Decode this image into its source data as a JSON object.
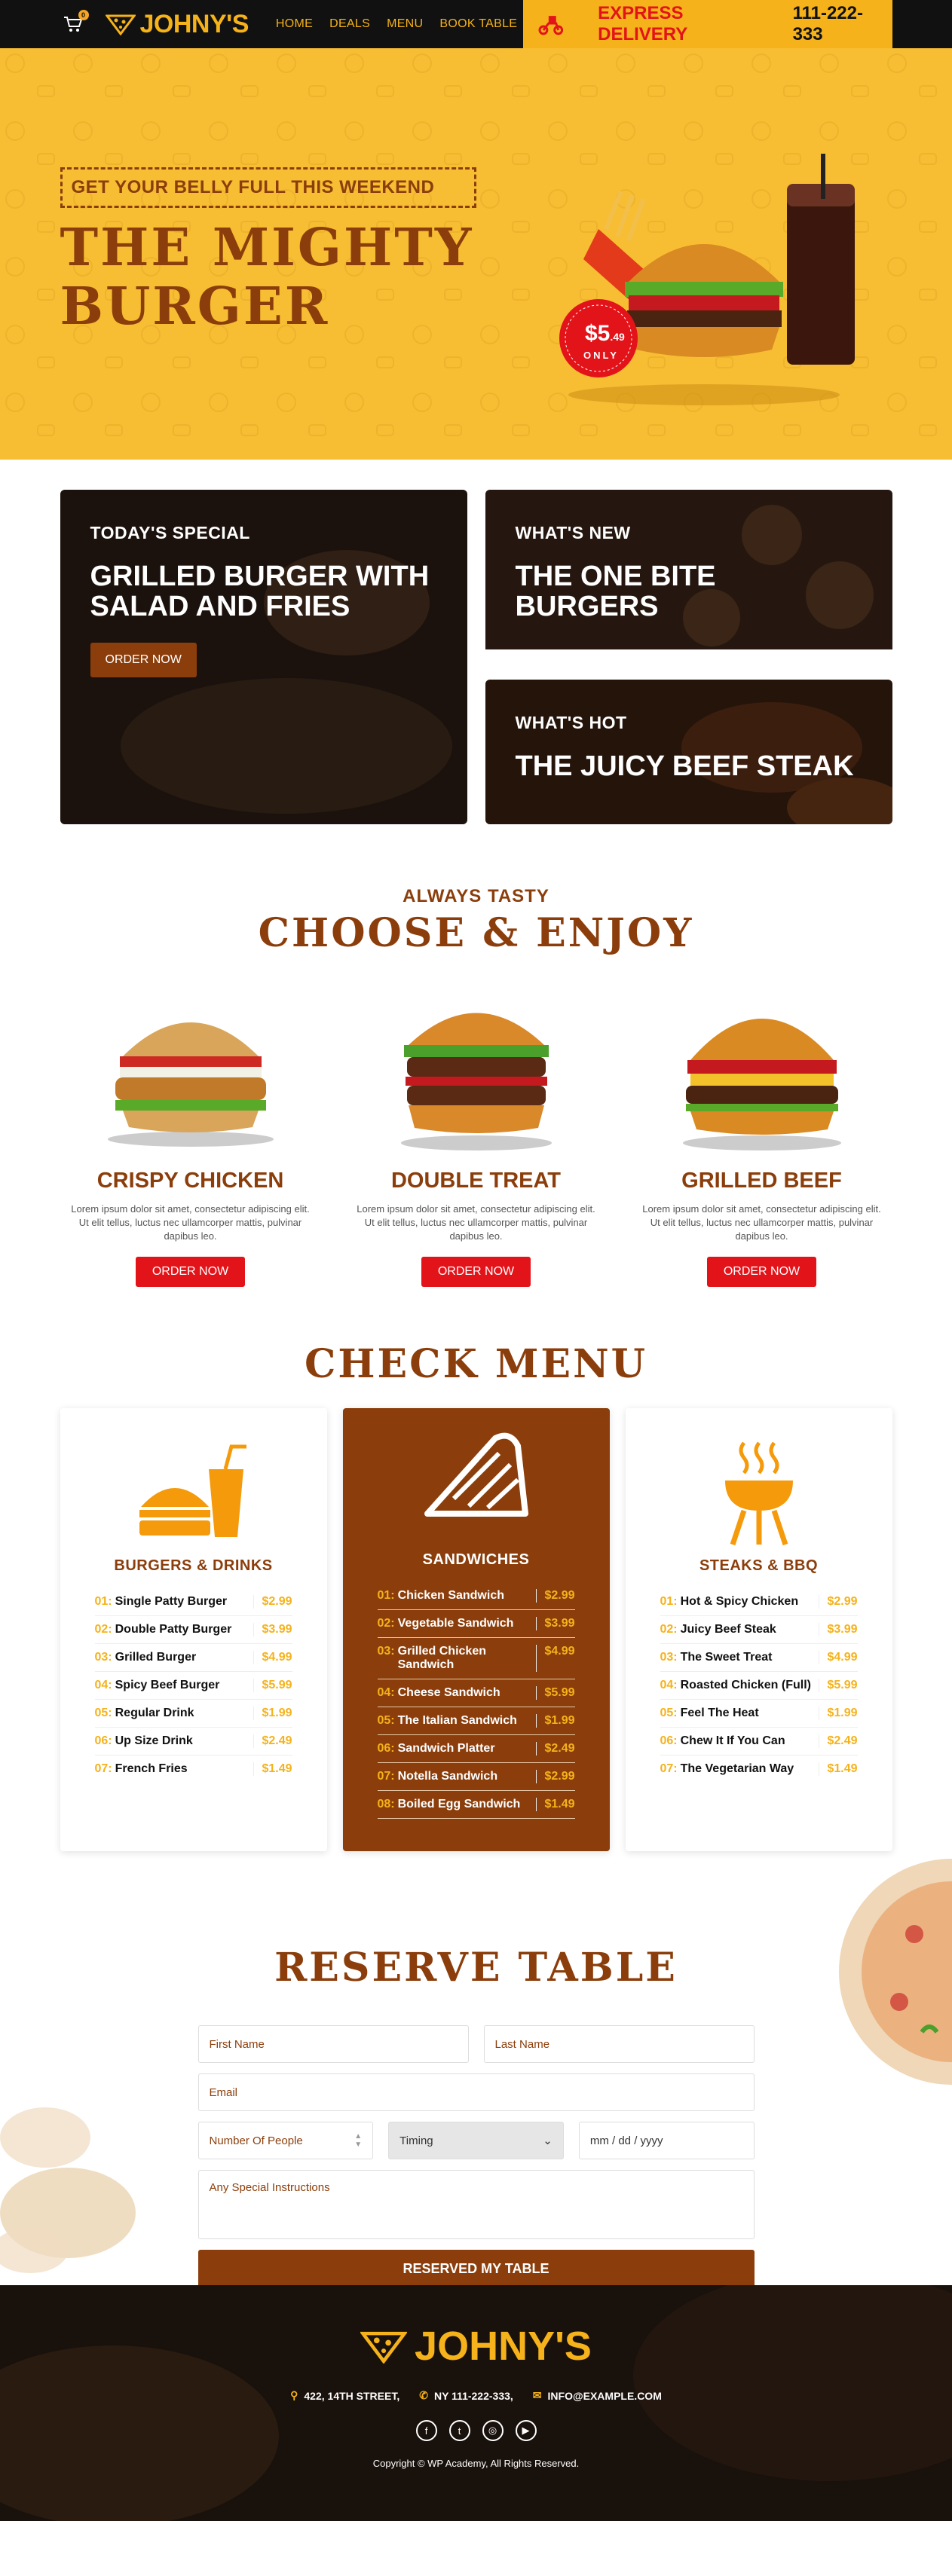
{
  "header": {
    "cart_count": "0",
    "brand": "JOHNY'S",
    "nav": [
      "HOME",
      "DEALS",
      "MENU",
      "BOOK TABLE"
    ],
    "express_label": "EXPRESS DELIVERY",
    "express_phone": "111-222-333"
  },
  "hero": {
    "tagline": "GET YOUR BELLY FULL THIS WEEKEND",
    "title_line1": "THE MIGHTY",
    "title_line2": "BURGER",
    "price_big": "$5",
    "price_cents": ".49",
    "price_only": "ONLY"
  },
  "specials": [
    {
      "kicker": "TODAY'S SPECIAL",
      "title": "GRILLED BURGER WITH SALAD AND FRIES",
      "button": "ORDER NOW"
    },
    {
      "kicker": "WHAT'S NEW",
      "title": "THE ONE BITE BURGERS"
    },
    {
      "kicker": "WHAT'S HOT",
      "title": "THE JUICY BEEF STEAK"
    }
  ],
  "choose": {
    "kicker": "ALWAYS TASTY",
    "title": "CHOOSE & ENJOY",
    "products": [
      {
        "name": "CRISPY CHICKEN",
        "desc": "Lorem ipsum dolor sit amet, consectetur adipiscing elit. Ut elit tellus, luctus nec ullamcorper mattis, pulvinar dapibus leo.",
        "button": "ORDER NOW"
      },
      {
        "name": "DOUBLE TREAT",
        "desc": "Lorem ipsum dolor sit amet, consectetur adipiscing elit. Ut elit tellus, luctus nec ullamcorper mattis, pulvinar dapibus leo.",
        "button": "ORDER NOW"
      },
      {
        "name": "GRILLED BEEF",
        "desc": "Lorem ipsum dolor sit amet, consectetur adipiscing elit. Ut elit tellus, luctus nec ullamcorper mattis, pulvinar dapibus leo.",
        "button": "ORDER NOW"
      }
    ]
  },
  "menu": {
    "title": "CHECK MENU",
    "columns": [
      {
        "title": "BURGERS & DRINKS",
        "items": [
          {
            "num": "01:",
            "name": "Single Patty Burger",
            "price": "$2.99"
          },
          {
            "num": "02:",
            "name": "Double Patty Burger",
            "price": "$3.99"
          },
          {
            "num": "03:",
            "name": "Grilled Burger",
            "price": "$4.99"
          },
          {
            "num": "04:",
            "name": "Spicy Beef Burger",
            "price": "$5.99"
          },
          {
            "num": "05:",
            "name": "Regular Drink",
            "price": "$1.99"
          },
          {
            "num": "06:",
            "name": "Up Size Drink",
            "price": "$2.49"
          },
          {
            "num": "07:",
            "name": "French Fries",
            "price": "$1.49"
          }
        ]
      },
      {
        "title": "SANDWICHES",
        "items": [
          {
            "num": "01:",
            "name": "Chicken Sandwich",
            "price": "$2.99"
          },
          {
            "num": "02:",
            "name": "Vegetable Sandwich",
            "price": "$3.99"
          },
          {
            "num": "03:",
            "name": "Grilled Chicken Sandwich",
            "price": "$4.99"
          },
          {
            "num": "04:",
            "name": "Cheese Sandwich",
            "price": "$5.99"
          },
          {
            "num": "05:",
            "name": "The Italian Sandwich",
            "price": "$1.99"
          },
          {
            "num": "06:",
            "name": "Sandwich Platter",
            "price": "$2.49"
          },
          {
            "num": "07:",
            "name": "Notella Sandwich",
            "price": "$2.99"
          },
          {
            "num": "08:",
            "name": "Boiled Egg Sandwich",
            "price": "$1.49"
          }
        ]
      },
      {
        "title": "STEAKS & BBQ",
        "items": [
          {
            "num": "01:",
            "name": "Hot & Spicy Chicken",
            "price": "$2.99"
          },
          {
            "num": "02:",
            "name": "Juicy Beef Steak",
            "price": "$3.99"
          },
          {
            "num": "03:",
            "name": "The Sweet Treat",
            "price": "$4.99"
          },
          {
            "num": "04:",
            "name": "Roasted Chicken (Full)",
            "price": "$5.99"
          },
          {
            "num": "05:",
            "name": "Feel The Heat",
            "price": "$1.99"
          },
          {
            "num": "06:",
            "name": "Chew It If You Can",
            "price": "$2.49"
          },
          {
            "num": "07:",
            "name": "The Vegetarian Way",
            "price": "$1.49"
          }
        ]
      }
    ]
  },
  "reserve": {
    "title": "RESERVE TABLE",
    "first_name": "First Name",
    "last_name": "Last Name",
    "email": "Email",
    "people": "Number Of People",
    "timing": "Timing",
    "date": "mm / dd / yyyy",
    "instructions": "Any Special Instructions",
    "submit": "RESERVED MY TABLE"
  },
  "footer": {
    "brand": "JOHNY'S",
    "address": "422, 14TH STREET,",
    "phone": "NY 111-222-333,",
    "email": "INFO@EXAMPLE.COM",
    "copyright": "Copyright © WP Academy, All Rights Reserved."
  },
  "colors": {
    "brown": "#8b3e0b",
    "yellow": "#f5b21b",
    "red": "#e3131a",
    "dark": "#111111"
  }
}
